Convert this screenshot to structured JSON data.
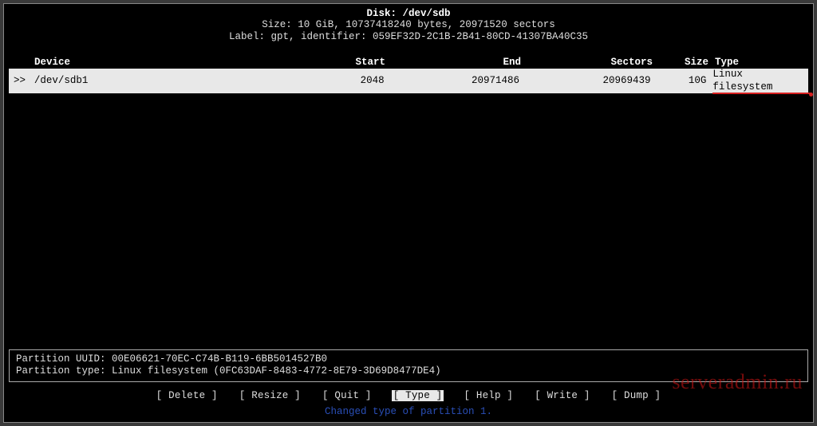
{
  "header": {
    "disk_label_prefix": "Disk: ",
    "disk_path": "/dev/sdb",
    "size_line": "Size: 10 GiB, 10737418240 bytes, 20971520 sectors",
    "label_line": "Label: gpt, identifier: 059EF32D-2C1B-2B41-80CD-41307BA40C35"
  },
  "columns": {
    "device": "Device",
    "start": "Start",
    "end": "End",
    "sectors": "Sectors",
    "size": "Size",
    "type": "Type"
  },
  "row": {
    "prefix": ">>",
    "device": "/dev/sdb1",
    "start": "2048",
    "end": "20971486",
    "sectors": "20969439",
    "size": "10G",
    "type": "Linux filesystem"
  },
  "info": {
    "uuid_line": "Partition UUID: 00E06621-70EC-C74B-B119-6BB5014527B0",
    "type_line": "Partition type: Linux filesystem (0FC63DAF-8483-4772-8E79-3D69D8477DE4)"
  },
  "menu": {
    "delete": "[ Delete ]",
    "resize": "[ Resize ]",
    "quit": "[  Quit  ]",
    "type": "[  Type  ]",
    "help": "[  Help  ]",
    "write": "[  Write ]",
    "dump": "[  Dump  ]"
  },
  "status": "Changed type of partition 1.",
  "watermark": "serveradmin.ru"
}
